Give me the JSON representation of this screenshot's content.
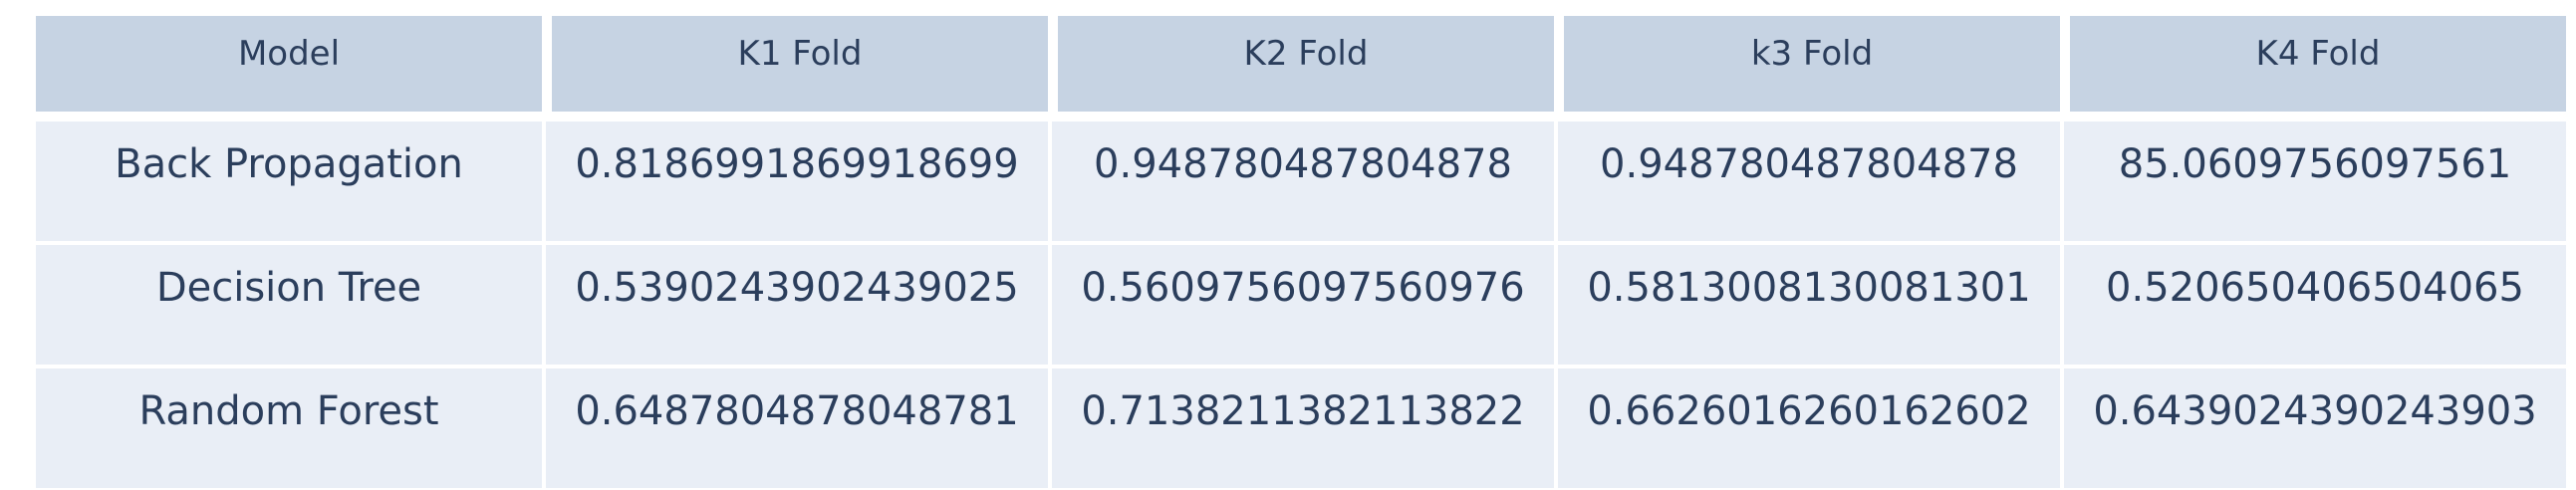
{
  "chart_data": {
    "type": "table",
    "columns": [
      "Model",
      "K1 Fold",
      "K2 Fold",
      "k3 Fold",
      "K4 Fold"
    ],
    "rows": [
      [
        "Back Propagation",
        "0.8186991869918699",
        "0.948780487804878",
        "0.948780487804878",
        "85.0609756097561"
      ],
      [
        "Decision Tree",
        "0.5390243902439025",
        "0.5609756097560976",
        "0.5813008130081301",
        "0.520650406504065"
      ],
      [
        "Random Forest",
        "0.6487804878048781",
        "0.7138211382113822",
        "0.6626016260162602",
        "0.6439024390243903"
      ]
    ]
  },
  "colors": {
    "header_bg": "#c6d3e3",
    "body_bg": "#e9eef6",
    "text": "#2b3e5c"
  }
}
